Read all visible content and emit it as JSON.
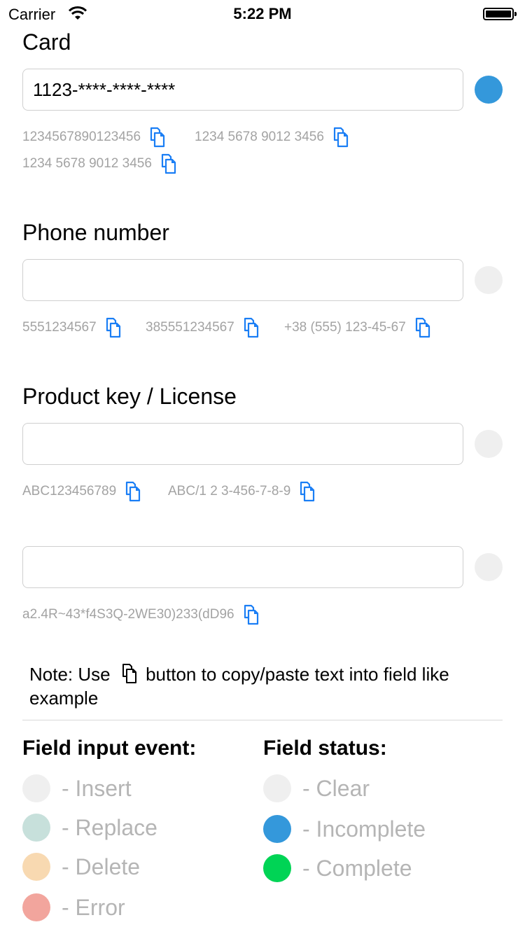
{
  "status_bar": {
    "carrier": "Carrier",
    "time": "5:22 PM"
  },
  "colors": {
    "clear": "#efefef",
    "incomplete": "#3498db",
    "complete": "#00d455",
    "insert": "#efefef",
    "replace": "#c7e0db",
    "delete": "#f8d9b1",
    "error": "#f2a59d",
    "icon_blue": "#1a7ef5"
  },
  "fields": [
    {
      "label": "Card",
      "value": "1123-****-****-****",
      "placeholder": "",
      "status": "incomplete",
      "examples": [
        "1234567890123456",
        "1234 5678 9012 3456",
        "1234 5678 9012 3456"
      ]
    },
    {
      "label": "Phone number",
      "value": "",
      "placeholder": "",
      "status": "clear",
      "examples": [
        "5551234567",
        "385551234567",
        "+38 (555) 123-45-67"
      ]
    },
    {
      "label": "Product key / License",
      "value": "",
      "placeholder": "",
      "status": "clear",
      "examples": [
        "ABC123456789",
        "ABC/1 2 3-456-7-8-9"
      ]
    },
    {
      "label": "",
      "value": "",
      "placeholder": "",
      "status": "clear",
      "examples": [
        "a2.4R~43*f4S3Q-2WE30)233(dD96"
      ]
    }
  ],
  "note": {
    "prefix": "Note: Use",
    "suffix": "button to copy/paste text into field like example"
  },
  "legend": {
    "input_event_title": "Field input event:",
    "input_events": [
      "- Insert",
      "- Replace",
      "- Delete",
      "- Error"
    ],
    "status_title": "Field status:",
    "statuses": [
      "- Clear",
      "- Incomplete",
      "- Complete"
    ]
  }
}
